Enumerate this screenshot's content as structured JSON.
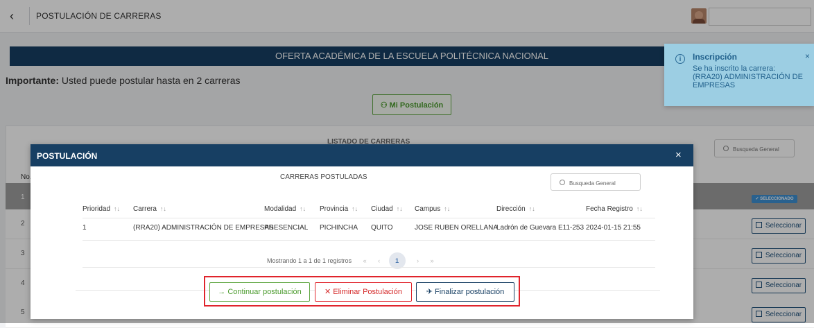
{
  "topbar": {
    "title": "POSTULACIÓN DE CARRERAS",
    "back_icon": "‹"
  },
  "banner": {
    "title": "OFERTA ACADÉMICA DE LA ESCUELA POLITÉCNICA NACIONAL"
  },
  "important": {
    "label": "Importante:",
    "text": " Usted puede postular hasta en 2 carreras"
  },
  "mi_postulacion": {
    "label": "Mi Postulación",
    "icon": "user-icon"
  },
  "listado": {
    "title": "LISTADO DE CARRERAS",
    "search_placeholder": "Busqueda General",
    "col_no": "No.",
    "rows": [
      {
        "num": "1",
        "action": "SELECCIONADO"
      },
      {
        "num": "2",
        "action": "Seleccionar"
      },
      {
        "num": "3",
        "action": "Seleccionar"
      },
      {
        "num": "4",
        "action": "Seleccionar"
      },
      {
        "num": "5",
        "action": "Seleccionar"
      }
    ]
  },
  "modal": {
    "title": "POSTULACIÓN",
    "close": "×",
    "subtitle": "CARRERAS POSTULADAS",
    "search_placeholder": "Busqueda General",
    "columns": [
      "Prioridad",
      "Carrera",
      "Modalidad",
      "Provincia",
      "Ciudad",
      "Campus",
      "Dirección",
      "Fecha Registro"
    ],
    "sort_icon": "↑↓",
    "rows": [
      [
        "1",
        "(RRA20) ADMINISTRACIÓN DE EMPRESAS",
        "PRESENCIAL",
        "PICHINCHA",
        "QUITO",
        "JOSE RUBEN ORELLANA",
        "Ladrón de Guevara E11-253",
        "2024-01-15 21:55"
      ]
    ],
    "pager": {
      "info": "Mostrando 1 a 1 de 1 registros",
      "first": "«",
      "prev": "‹",
      "current": "1",
      "next": "›",
      "last": "»"
    },
    "buttons": {
      "continuar": "→ Continuar postulación",
      "eliminar": "✕ Eliminar Postulación",
      "finalizar": "✈ Finalizar postulación"
    }
  },
  "toast": {
    "title": "Inscripción",
    "message": "Se ha inscrito la carrera: (RRA20) ADMINISTRACIÓN DE EMPRESAS",
    "icon": "i",
    "close": "×"
  },
  "colors": {
    "navy": "#173f63",
    "green": "#4a9a2c",
    "red": "#e0242c",
    "toast": "#9ccee3"
  }
}
